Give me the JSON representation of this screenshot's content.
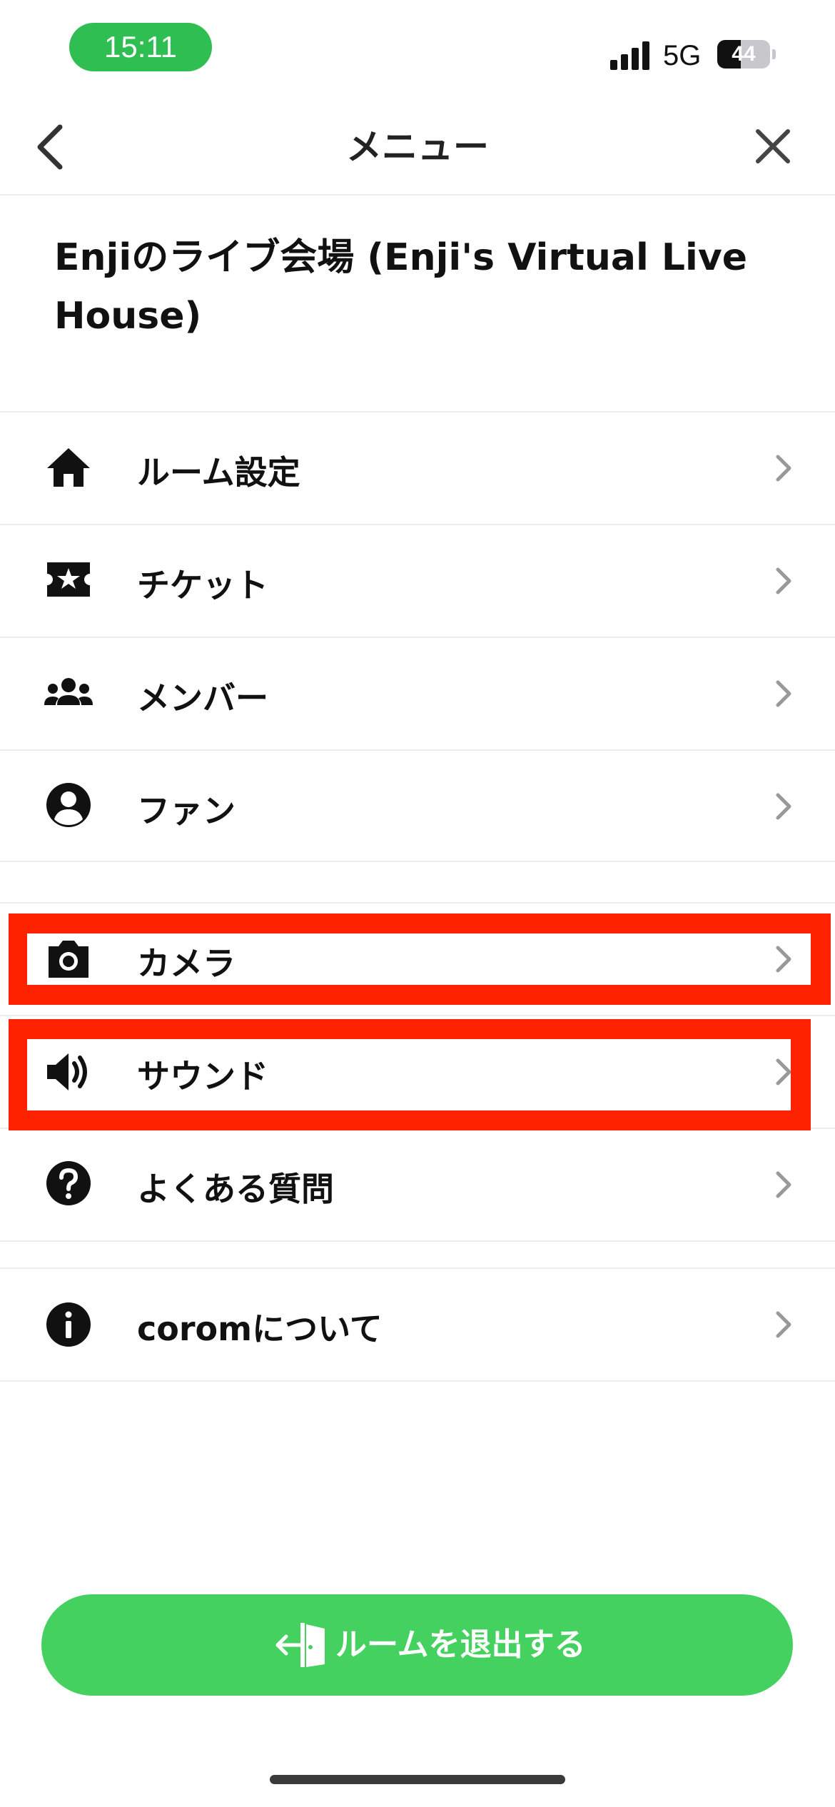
{
  "status_bar": {
    "time": "15:11",
    "network": "5G",
    "battery_percent": 44,
    "battery_label": "44",
    "signal_bars": 4
  },
  "header": {
    "title": "メニュー",
    "back_icon": "chevron-left-icon",
    "close_icon": "close-icon"
  },
  "room": {
    "title": "Enjiのライブ会場 (Enji's Virtual Live House)"
  },
  "menu": {
    "group1": [
      {
        "label": "ルーム設定",
        "icon": "home-icon"
      },
      {
        "label": "チケット",
        "icon": "ticket-star-icon"
      },
      {
        "label": "メンバー",
        "icon": "members-icon"
      },
      {
        "label": "ファン",
        "icon": "account-circle-icon"
      }
    ],
    "group2": [
      {
        "label": "カメラ",
        "icon": "camera-icon"
      },
      {
        "label": "サウンド",
        "icon": "speaker-icon"
      },
      {
        "label": "よくある質問",
        "icon": "help-circle-icon"
      }
    ],
    "group3": [
      {
        "label": "coromについて",
        "icon": "info-circle-icon"
      }
    ]
  },
  "highlight": {
    "color": "#ff2200",
    "highlighted_items": [
      "カメラ",
      "サウンド"
    ]
  },
  "exit_button": {
    "label": "ルームを退出する",
    "icon": "exit-door-icon",
    "color": "#45d15f"
  },
  "colors": {
    "accent_green": "#45d15f",
    "status_green": "#2fbe52",
    "divider": "#ececec"
  }
}
